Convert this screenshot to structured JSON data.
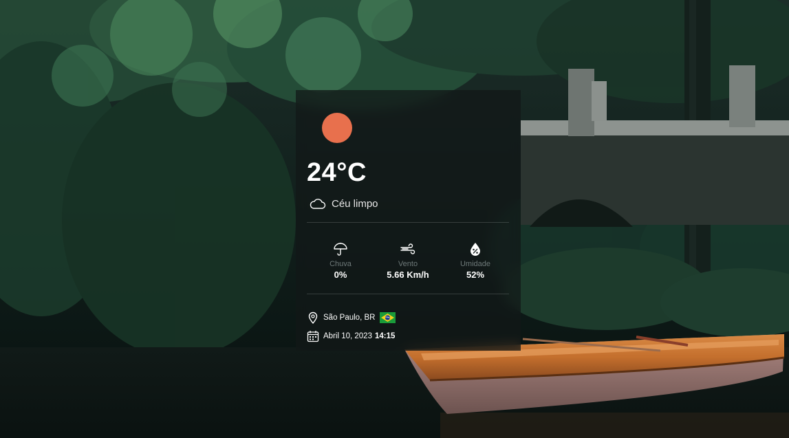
{
  "weather": {
    "temperature": "24°C",
    "condition": "Céu limpo",
    "sun_color": "#e8704d",
    "condition_icon": "cloud-icon"
  },
  "stats": [
    {
      "icon": "umbrella-icon",
      "label": "Chuva",
      "value": "0%"
    },
    {
      "icon": "wind-icon",
      "label": "Vento",
      "value": "5.66 Km/h"
    },
    {
      "icon": "humidity-icon",
      "label": "Umidade",
      "value": "52%"
    }
  ],
  "location": {
    "city": "São Paulo, BR",
    "flag_icon": "brazil-flag-icon",
    "date": "Abril 10, 2023",
    "time": "14:15"
  },
  "background": {
    "description_icon": "forest-river-boat-photo"
  }
}
